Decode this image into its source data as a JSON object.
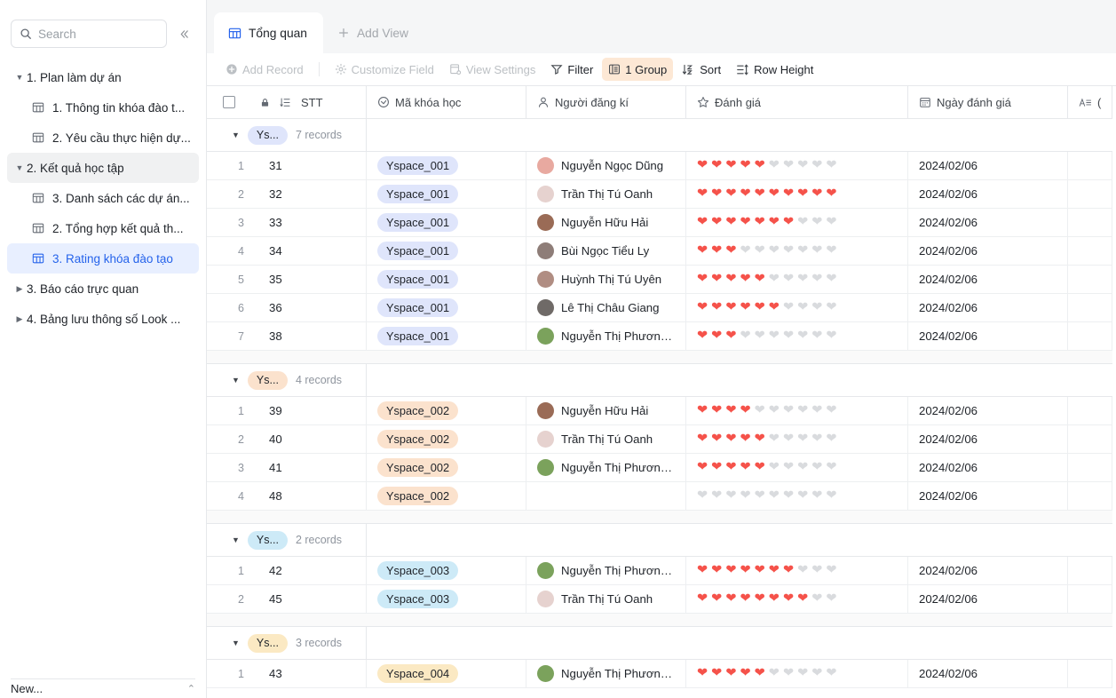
{
  "sidebar": {
    "search": {
      "placeholder": "Search",
      "icon": "search-icon"
    },
    "collapse_icon": "«",
    "items": [
      {
        "label": "1. Plan làm dự án",
        "type": "group",
        "expanded": true,
        "state": "normal"
      },
      {
        "label": "1. Thông tin khóa đào t...",
        "type": "table",
        "state": "normal"
      },
      {
        "label": "2. Yêu cầu thực hiện dự...",
        "type": "table",
        "state": "normal"
      },
      {
        "label": "2. Kết quả học tập",
        "type": "group",
        "expanded": true,
        "state": "active-group"
      },
      {
        "label": "3. Danh sách các dự án...",
        "type": "table",
        "state": "normal"
      },
      {
        "label": "2. Tổng hợp kết quả th...",
        "type": "table",
        "state": "normal"
      },
      {
        "label": "3. Rating khóa đào tạo",
        "type": "table",
        "state": "active-leaf"
      },
      {
        "label": "3. Báo cáo trực quan",
        "type": "group",
        "expanded": false,
        "state": "normal"
      },
      {
        "label": "4. Bảng lưu thông số Look ...",
        "type": "group",
        "expanded": false,
        "state": "normal"
      }
    ],
    "footer": {
      "label": "New...",
      "chevron": "⌃"
    }
  },
  "tabs": [
    {
      "label": "Tổng quan",
      "icon": "table-icon",
      "active": true
    },
    {
      "label": "Add View",
      "icon": "plus-icon",
      "active": false
    }
  ],
  "toolbar": [
    {
      "label": "Add Record",
      "icon": "plus-circle-icon",
      "state": "dim"
    },
    {
      "label": "Customize Field",
      "icon": "gear-icon",
      "state": "dim"
    },
    {
      "label": "View Settings",
      "icon": "view-settings-icon",
      "state": "dim"
    },
    {
      "label": "Filter",
      "icon": "filter-icon",
      "state": "on"
    },
    {
      "label": "1 Group",
      "icon": "group-icon",
      "state": "badge"
    },
    {
      "label": "Sort",
      "icon": "sort-icon",
      "state": "on"
    },
    {
      "label": "Row Height",
      "icon": "row-height-icon",
      "state": "on"
    }
  ],
  "colors": {
    "accent": "#2563eb",
    "badge_bg": "#fde8d5",
    "heart_on": "#f5524a",
    "heart_off": "#d9dbde",
    "chip_001": "#dfe5fb",
    "chip_002": "#fbe2cd",
    "chip_003": "#cdeaf7",
    "chip_004": "#fbe9c3"
  },
  "grid": {
    "columns": [
      {
        "key": "stt",
        "label": "STT",
        "icon": "order-icon",
        "lock": "lock-icon"
      },
      {
        "key": "code",
        "label": "Mã khóa học",
        "icon": "select-icon"
      },
      {
        "key": "user",
        "label": "Người đăng kí",
        "icon": "person-icon"
      },
      {
        "key": "rate",
        "label": "Đánh giá",
        "icon": "star-icon"
      },
      {
        "key": "date",
        "label": "Ngày đánh giá",
        "icon": "calendar-icon"
      },
      {
        "key": "text",
        "label": "(",
        "icon": "text-icon"
      }
    ],
    "rating_max": 10,
    "groups": [
      {
        "chip": "Ys...",
        "chip_color": "#dfe5fb",
        "count_label": "7 records",
        "rows": [
          {
            "n": 1,
            "stt": "31",
            "code": "Yspace_001",
            "user": "Nguyễn Ngọc Dũng",
            "avatar": "#e8a9a0",
            "rating": 5,
            "date": "2024/02/06"
          },
          {
            "n": 2,
            "stt": "32",
            "code": "Yspace_001",
            "user": "Trần Thị Tú Oanh",
            "avatar": "#e6d2cf",
            "rating": 10,
            "date": "2024/02/06"
          },
          {
            "n": 3,
            "stt": "33",
            "code": "Yspace_001",
            "user": "Nguyễn Hữu Hải",
            "avatar": "#9a6b56",
            "rating": 7,
            "date": "2024/02/06"
          },
          {
            "n": 4,
            "stt": "34",
            "code": "Yspace_001",
            "user": "Bùi Ngọc Tiểu Ly",
            "avatar": "#8e7d78",
            "rating": 3,
            "date": "2024/02/06"
          },
          {
            "n": 5,
            "stt": "35",
            "code": "Yspace_001",
            "user": "Huỳnh Thị Tú Uyên",
            "avatar": "#b08d82",
            "rating": 5,
            "date": "2024/02/06"
          },
          {
            "n": 6,
            "stt": "36",
            "code": "Yspace_001",
            "user": "Lê Thị Châu Giang",
            "avatar": "#6f6a67",
            "rating": 6,
            "date": "2024/02/06"
          },
          {
            "n": 7,
            "stt": "38",
            "code": "Yspace_001",
            "user": "Nguyễn Thị Phương ...",
            "avatar": "#7ba25c",
            "rating": 3,
            "date": "2024/02/06"
          }
        ]
      },
      {
        "chip": "Ys...",
        "chip_color": "#fbe2cd",
        "count_label": "4 records",
        "rows": [
          {
            "n": 1,
            "stt": "39",
            "code": "Yspace_002",
            "user": "Nguyễn Hữu Hải",
            "avatar": "#9a6b56",
            "rating": 4,
            "date": "2024/02/06"
          },
          {
            "n": 2,
            "stt": "40",
            "code": "Yspace_002",
            "user": "Trần Thị Tú Oanh",
            "avatar": "#e6d2cf",
            "rating": 5,
            "date": "2024/02/06"
          },
          {
            "n": 3,
            "stt": "41",
            "code": "Yspace_002",
            "user": "Nguyễn Thị Phương ...",
            "avatar": "#7ba25c",
            "rating": 5,
            "date": "2024/02/06"
          },
          {
            "n": 4,
            "stt": "48",
            "code": "Yspace_002",
            "user": "",
            "avatar": "",
            "rating": 0,
            "date": "2024/02/06"
          }
        ]
      },
      {
        "chip": "Ys...",
        "chip_color": "#cdeaf7",
        "count_label": "2 records",
        "rows": [
          {
            "n": 1,
            "stt": "42",
            "code": "Yspace_003",
            "user": "Nguyễn Thị Phương ...",
            "avatar": "#7ba25c",
            "rating": 7,
            "date": "2024/02/06"
          },
          {
            "n": 2,
            "stt": "45",
            "code": "Yspace_003",
            "user": "Trần Thị Tú Oanh",
            "avatar": "#e6d2cf",
            "rating": 8,
            "date": "2024/02/06"
          }
        ]
      },
      {
        "chip": "Ys...",
        "chip_color": "#fbe9c3",
        "count_label": "3 records",
        "rows": [
          {
            "n": 1,
            "stt": "43",
            "code": "Yspace_004",
            "user": "Nguyễn Thị Phương ...",
            "avatar": "#7ba25c",
            "rating": 5,
            "date": "2024/02/06"
          }
        ]
      }
    ]
  }
}
